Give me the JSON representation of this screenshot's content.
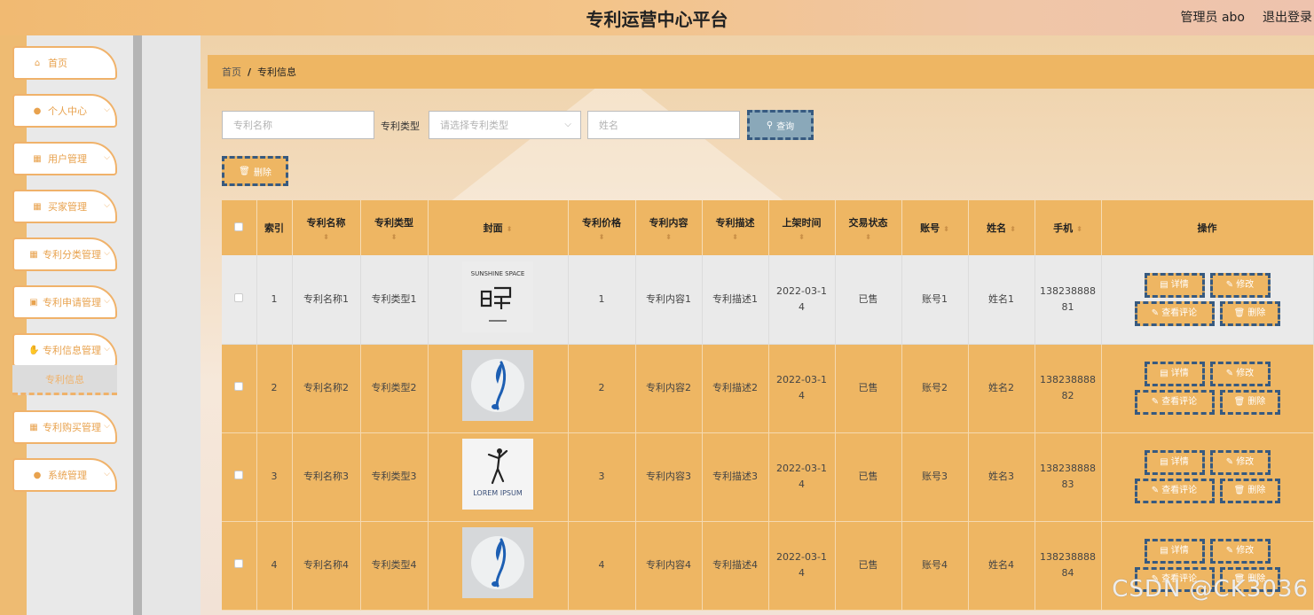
{
  "header": {
    "title": "专利运营中心平台",
    "admin": "管理员 abo",
    "logout": "退出登录"
  },
  "sidebar": {
    "items": [
      {
        "label": "首页",
        "icon": "home-icon",
        "glyph": "⌂",
        "chevron": false
      },
      {
        "label": "个人中心",
        "icon": "user-icon",
        "glyph": "●",
        "chevron": true
      },
      {
        "label": "用户管理",
        "icon": "grid-icon",
        "glyph": "▦",
        "chevron": true
      },
      {
        "label": "买家管理",
        "icon": "grid-icon",
        "glyph": "▦",
        "chevron": true
      },
      {
        "label": "专利分类管理",
        "icon": "grid-icon",
        "glyph": "▦",
        "chevron": true
      },
      {
        "label": "专利申请管理",
        "icon": "doc-icon",
        "glyph": "▣",
        "chevron": true
      },
      {
        "label": "专利信息管理",
        "icon": "thumb-icon",
        "glyph": "✋",
        "chevron": true
      },
      {
        "label": "专利购买管理",
        "icon": "grid-icon",
        "glyph": "▦",
        "chevron": true
      },
      {
        "label": "系统管理",
        "icon": "user-icon",
        "glyph": "●",
        "chevron": true
      }
    ],
    "sub_item": "专利信息"
  },
  "breadcrumb": {
    "home": "首页",
    "separator": "/",
    "current": "专利信息"
  },
  "search": {
    "name_placeholder": "专利名称",
    "type_label": "专利类型",
    "type_placeholder": "请选择专利类型",
    "person_placeholder": "姓名",
    "query_label": "查询",
    "delete_label": "删除"
  },
  "table": {
    "columns": [
      {
        "label": "",
        "sortable": false
      },
      {
        "label": "索引",
        "sortable": false
      },
      {
        "label": "专利名称",
        "sortable": true
      },
      {
        "label": "专利类型",
        "sortable": true
      },
      {
        "label": "封面",
        "sortable": true
      },
      {
        "label": "专利价格",
        "sortable": true
      },
      {
        "label": "专利内容",
        "sortable": true
      },
      {
        "label": "专利描述",
        "sortable": true
      },
      {
        "label": "上架时间",
        "sortable": true
      },
      {
        "label": "交易状态",
        "sortable": true
      },
      {
        "label": "账号",
        "sortable": true
      },
      {
        "label": "姓名",
        "sortable": true
      },
      {
        "label": "手机",
        "sortable": true
      },
      {
        "label": "操作",
        "sortable": false
      }
    ],
    "rows": [
      {
        "index": "1",
        "name": "专利名称1",
        "type": "专利类型1",
        "cover": "sunshine",
        "price": "1",
        "content": "专利内容1",
        "desc": "专利描述1",
        "time_a": "2022-03-1",
        "time_b": "4",
        "status": "已售",
        "account": "账号1",
        "person": "姓名1",
        "phone_a": "138238888",
        "phone_b": "81"
      },
      {
        "index": "2",
        "name": "专利名称2",
        "type": "专利类型2",
        "cover": "feather",
        "price": "2",
        "content": "专利内容2",
        "desc": "专利描述2",
        "time_a": "2022-03-1",
        "time_b": "4",
        "status": "已售",
        "account": "账号2",
        "person": "姓名2",
        "phone_a": "138238888",
        "phone_b": "82"
      },
      {
        "index": "3",
        "name": "专利名称3",
        "type": "专利类型3",
        "cover": "dancer",
        "price": "3",
        "content": "专利内容3",
        "desc": "专利描述3",
        "time_a": "2022-03-1",
        "time_b": "4",
        "status": "已售",
        "account": "账号3",
        "person": "姓名3",
        "phone_a": "138238888",
        "phone_b": "83"
      },
      {
        "index": "4",
        "name": "专利名称4",
        "type": "专利类型4",
        "cover": "feather",
        "price": "4",
        "content": "专利内容4",
        "desc": "专利描述4",
        "time_a": "2022-03-1",
        "time_b": "4",
        "status": "已售",
        "account": "账号4",
        "person": "姓名4",
        "phone_a": "138238888",
        "phone_b": "84"
      }
    ],
    "actions": {
      "detail": "详情",
      "edit": "修改",
      "comments": "查看评论",
      "delete": "删除"
    }
  },
  "covers": {
    "sunshine_text": "SUNSHINE SPACE",
    "lorem_text": "LOREM IPSUM"
  },
  "watermark": "CSDN @CK3036",
  "colors": {
    "accent": "#eeb663",
    "button_border": "#375a80",
    "sidebar_text": "#e8a24e"
  }
}
